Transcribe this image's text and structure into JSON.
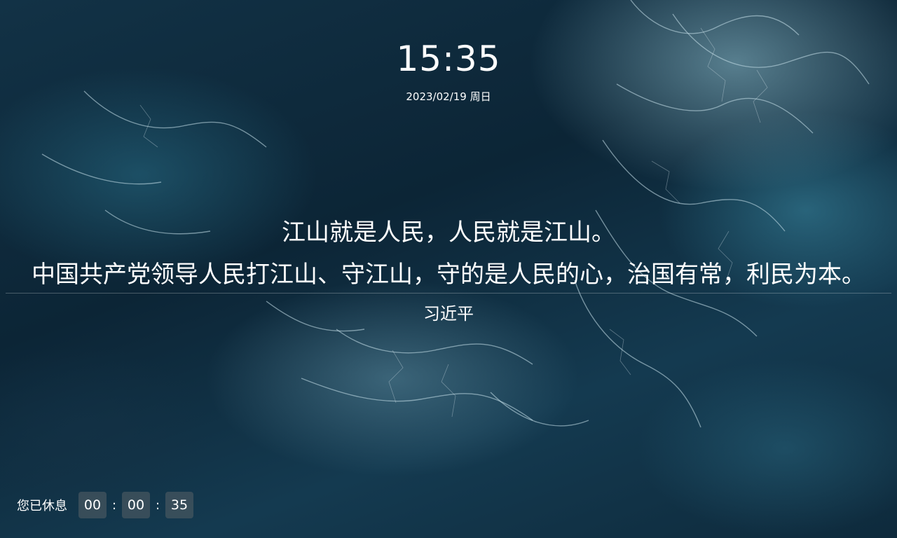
{
  "clock": {
    "time": "15:35",
    "date": "2023/02/19 周日"
  },
  "quote": {
    "lines": [
      "江山就是人民，人民就是江山。",
      "中国共产党领导人民打江山、守江山，守的是人民的心，治国有常，利民为本。"
    ],
    "author": "习近平"
  },
  "rest_timer": {
    "label": "您已休息",
    "hours": "00",
    "minutes": "00",
    "seconds": "35",
    "separator": ":"
  }
}
